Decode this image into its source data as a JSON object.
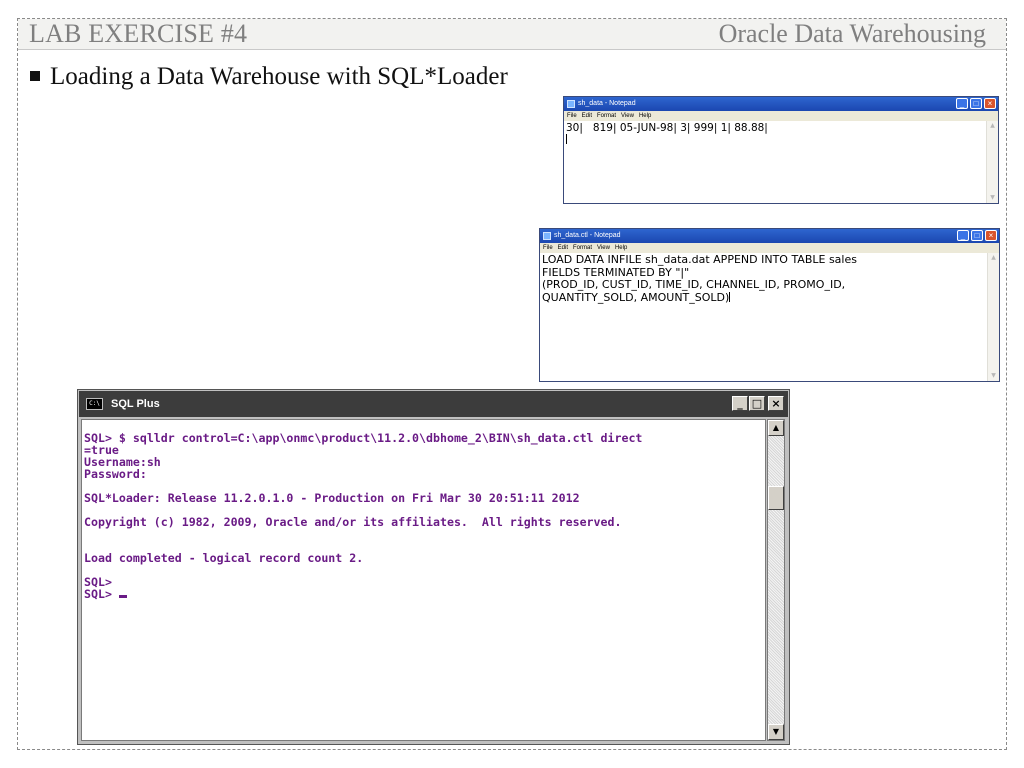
{
  "slide": {
    "title": "LAB EXERCISE #4",
    "subtitle": "Oracle Data Warehousing",
    "bullet": "Loading a Data Warehouse with SQL*Loader"
  },
  "notepad_data": {
    "title": "sh_data - Notepad",
    "menu": [
      "File",
      "Edit",
      "Format",
      "View",
      "Help"
    ],
    "content": "30|   819| 05-JUN-98| 3| 999| 1| 88.88|"
  },
  "notepad_ctl": {
    "title": "sh_data.ctl - Notepad",
    "menu": [
      "File",
      "Edit",
      "Format",
      "View",
      "Help"
    ],
    "content": "LOAD DATA INFILE sh_data.dat APPEND INTO TABLE sales\nFIELDS TERMINATED BY \"|\"\n(PROD_ID, CUST_ID, TIME_ID, CHANNEL_ID, PROMO_ID,\nQUANTITY_SOLD, AMOUNT_SOLD)"
  },
  "window_controls": {
    "minimize": "_",
    "maximize": "□",
    "close": "×",
    "scroll_up": "▲",
    "scroll_down": "▼"
  },
  "sqlplus": {
    "title": "SQL Plus",
    "icon_label": "C:\\",
    "console": "SQL> $ sqlldr control=C:\\app\\onmc\\product\\11.2.0\\dbhome_2\\BIN\\sh_data.ctl direct\n=true\nUsername:sh\nPassword:\n\nSQL*Loader: Release 11.2.0.1.0 - Production on Fri Mar 30 20:51:11 2012\n\nCopyright (c) 1982, 2009, Oracle and/or its affiliates.  All rights reserved.\n\n\nLoad completed - logical record count 2.\n\nSQL>\nSQL> "
  }
}
